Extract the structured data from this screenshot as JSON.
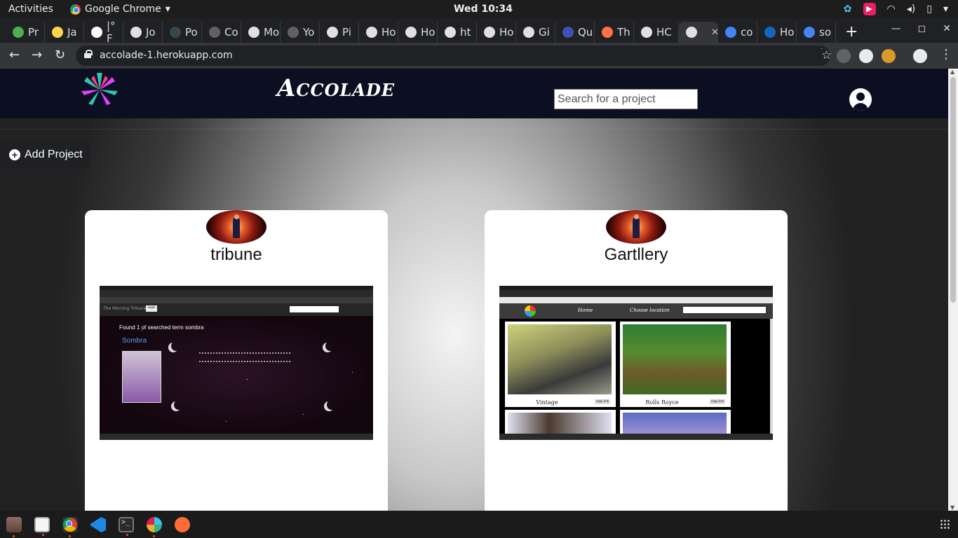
{
  "os_bar": {
    "activities": "Activities",
    "app_name": "Google Chrome",
    "clock": "Wed 10:34"
  },
  "browser": {
    "tabs": [
      {
        "label": "Pr",
        "color": "#4caf50"
      },
      {
        "label": "Ja",
        "color": "#ffd54f"
      },
      {
        "label": "|° F",
        "color": "#ffffff"
      },
      {
        "label": "Jo",
        "color": "#e0e0e0"
      },
      {
        "label": "Po",
        "color": "#37474f"
      },
      {
        "label": "Co",
        "color": "#616161"
      },
      {
        "label": "Mo",
        "color": "#e0e0e0"
      },
      {
        "label": "Yo",
        "color": "#616161"
      },
      {
        "label": "Pi",
        "color": "#e0e0e0"
      },
      {
        "label": "Ho",
        "color": "#e0e0e0"
      },
      {
        "label": "Ho",
        "color": "#e0e0e0"
      },
      {
        "label": "ht",
        "color": "#e0e0e0"
      },
      {
        "label": "Ho",
        "color": "#e0e0e0"
      },
      {
        "label": "Gi",
        "color": "#e0e0e0"
      },
      {
        "label": "Qu",
        "color": "#3f51b5"
      },
      {
        "label": "Th",
        "color": "#ff7043"
      },
      {
        "label": "HC",
        "color": "#e0e0e0"
      },
      {
        "label": "",
        "color": "#e0e0e0",
        "active": true
      },
      {
        "label": "co",
        "color": "#4285f4"
      },
      {
        "label": "Ho",
        "color": "#1565c0"
      },
      {
        "label": "so",
        "color": "#4285f4"
      }
    ],
    "new_tab": "+",
    "url": "accolade-1.herokuapp.com"
  },
  "site": {
    "brand": "Accolade",
    "search_placeholder": "Search for a project",
    "add_project_label": "Add Project"
  },
  "projects": [
    {
      "title": "tribune",
      "screenshot": {
        "site_name": "The Morning Tribune",
        "login": "Login",
        "found_text": "Found 1 of searched term sombra",
        "result_link": "Sombra"
      }
    },
    {
      "title": "Gartllery",
      "screenshot": {
        "nav_home": "Home",
        "nav_location": "Choose location",
        "photos": [
          {
            "caption": "Vintage",
            "copy": "copy link"
          },
          {
            "caption": "Rolls Royce",
            "copy": "copy link"
          }
        ]
      }
    }
  ],
  "dock": {
    "apps": [
      "files-icon",
      "text-editor-icon",
      "chrome-icon",
      "vscode-icon",
      "terminal-icon",
      "slack-icon",
      "postman-icon"
    ]
  }
}
